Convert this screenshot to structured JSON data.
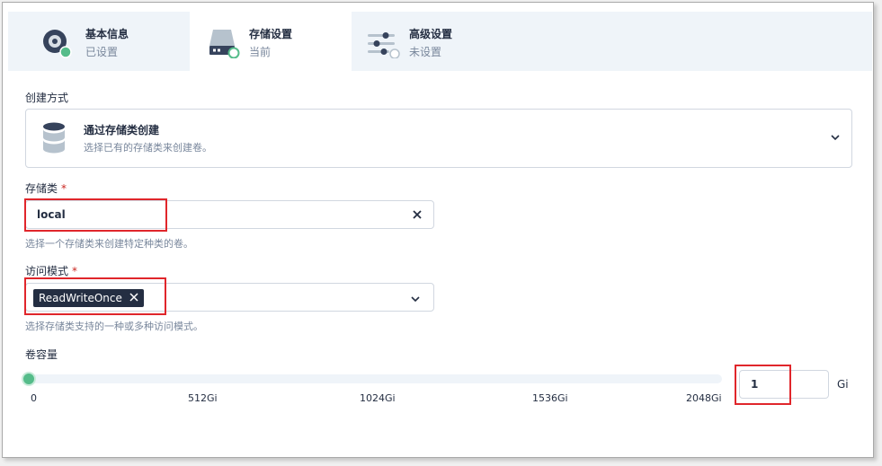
{
  "steps": [
    {
      "title": "基本信息",
      "status": "已设置",
      "icon": "info-disc-icon",
      "state_color": "#55bc8a"
    },
    {
      "title": "存储设置",
      "status": "当前",
      "icon": "storage-drive-icon",
      "state_color": "#55bc8a"
    },
    {
      "title": "高级设置",
      "status": "未设置",
      "icon": "sliders-icon",
      "state_color": "#ffffff"
    }
  ],
  "creation_method": {
    "label": "创建方式",
    "title": "通过存储类创建",
    "description": "选择已有的存储类来创建卷。",
    "icon": "database-icon"
  },
  "storage_class": {
    "label": "存储类",
    "required_mark": "*",
    "value": "local",
    "description": "选择一个存储类来创建特定种类的卷。"
  },
  "access_mode": {
    "label": "访问模式",
    "required_mark": "*",
    "selected_tag": "ReadWriteOnce",
    "description": "选择存储类支持的一种或多种访问模式。"
  },
  "capacity": {
    "label": "卷容量",
    "ticks": [
      "0",
      "512Gi",
      "1024Gi",
      "1536Gi",
      "2048Gi"
    ],
    "value": "1",
    "unit": "Gi",
    "slider_fraction": 0.0
  },
  "colors": {
    "accent_green": "#55bc8a",
    "highlight_red": "#e0262b",
    "text_dark": "#242e42",
    "text_muted": "#79879c"
  }
}
